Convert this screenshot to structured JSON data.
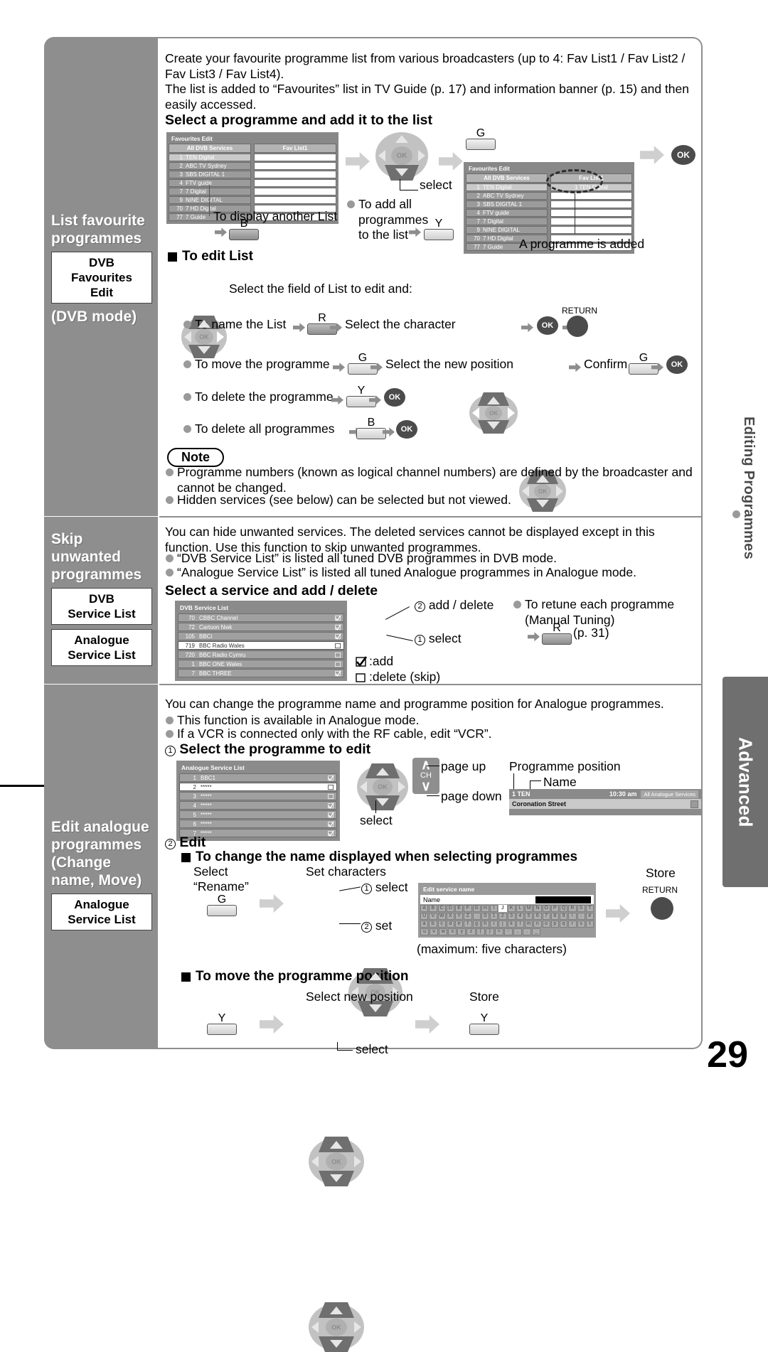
{
  "page_number": "29",
  "side_tabs": {
    "editing": "Editing Programmes",
    "advanced": "Advanced"
  },
  "sidebar": [
    {
      "title": "List favourite programmes",
      "buttons": [
        "DVB\nFavourites\nEdit"
      ],
      "mode": "(DVB mode)"
    },
    {
      "title": "Skip unwanted programmes",
      "buttons": [
        "DVB\nService List",
        "Analogue\nService List"
      ],
      "mode": ""
    },
    {
      "title": "Edit analogue programmes (Change name, Move)",
      "buttons": [
        "Analogue\nService List"
      ],
      "mode": ""
    }
  ],
  "section1": {
    "intro1": "Create your favourite programme list from various broadcasters (up to 4: Fav List1 / Fav List2 / Fav List3 / Fav List4).",
    "intro2": "The list is added to “Favourites” list in TV Guide (p. 17) and information banner (p. 15) and then easily accessed.",
    "heading": "Select a programme and add it to the list",
    "screen1": {
      "title": "Favourites Edit",
      "col1_header": "All DVB Services",
      "col2_header": "Fav List1",
      "rows": [
        {
          "num": "1",
          "name": "TEN Digital"
        },
        {
          "num": "2",
          "name": "ABC TV Sydney"
        },
        {
          "num": "3",
          "name": "SBS DIGITAL 1"
        },
        {
          "num": "4",
          "name": "FTV guide"
        },
        {
          "num": "7",
          "name": "7 Digital"
        },
        {
          "num": "9",
          "name": "NINE DIGITAL"
        },
        {
          "num": "70",
          "name": "7 HD Digital"
        },
        {
          "num": "77",
          "name": "7 Guide"
        }
      ]
    },
    "screen2": {
      "title": "Favourites Edit",
      "col1_header": "All DVB Services",
      "col2_header": "Fav List1",
      "added_row": "1 TEN Digital"
    },
    "select_label": "select",
    "key_G": "G",
    "key_Y": "Y",
    "key_B": "B",
    "key_R": "R",
    "ok_label": "OK",
    "display_another": "To display another List",
    "add_all": "To add all programmes to the list",
    "programme_added": "A programme is added",
    "edit_list_heading": "To edit List",
    "select_field": "Select the field of List to edit and:",
    "name_list": "To name the List",
    "select_char": "Select the character",
    "return_label": "RETURN",
    "move_prog": "To move the programme",
    "select_new_pos": "Select the new position",
    "confirm": "Confirm",
    "delete_prog": "To delete the programme",
    "delete_all": "To delete all programmes",
    "note_title": "Note",
    "notes": [
      "Programme numbers (known as logical channel numbers) are defined by the broadcaster and cannot be changed.",
      "Hidden services (see below) can be selected but not viewed."
    ]
  },
  "section2": {
    "intro": "You can hide unwanted services. The deleted services cannot be displayed except in this function. Use this function to skip unwanted programmes.",
    "bullets": [
      "“DVB Service List” is listed all tuned DVB programmes in DVB mode.",
      "“Analogue Service List” is listed all tuned Analogue programmes in Analogue mode."
    ],
    "heading": "Select a service and add / delete",
    "screen": {
      "title": "DVB Service List",
      "rows": [
        {
          "num": "70",
          "name": "CBBC Channel",
          "checked": true,
          "sel": false
        },
        {
          "num": "72",
          "name": "Cartoon Nwk",
          "checked": true,
          "sel": false
        },
        {
          "num": "105",
          "name": "BBCi",
          "checked": true,
          "sel": false
        },
        {
          "num": "719",
          "name": "BBC Radio Wales",
          "checked": false,
          "sel": true
        },
        {
          "num": "720",
          "name": "BBC Radio Cymru",
          "checked": false,
          "sel": false
        },
        {
          "num": "1",
          "name": "BBC ONE Wales",
          "checked": false,
          "sel": false
        },
        {
          "num": "7",
          "name": "BBC THREE",
          "checked": true,
          "sel": false
        }
      ]
    },
    "step2": "add / delete",
    "step1": "select",
    "legend_add": ":add",
    "legend_delete": ":delete (skip)",
    "retune": "To retune each programme (Manual Tuning)",
    "retune_key": "R",
    "retune_page": "(p. 31)"
  },
  "section3": {
    "intro": "You can change the programme name and programme position for Analogue programmes.",
    "bullets": [
      "This function is available in Analogue mode.",
      "If a VCR is connected only with the RF cable, edit “VCR”."
    ],
    "step1_heading": "Select the programme to edit",
    "screen": {
      "title": "Analogue Service List",
      "rows": [
        {
          "num": "1",
          "name": "BBC1",
          "checked": true,
          "sel": false
        },
        {
          "num": "2",
          "name": "*****",
          "checked": false,
          "sel": true
        },
        {
          "num": "3",
          "name": "*****",
          "checked": false,
          "sel": false
        },
        {
          "num": "4",
          "name": "*****",
          "checked": true,
          "sel": false
        },
        {
          "num": "5",
          "name": "*****",
          "checked": true,
          "sel": false
        },
        {
          "num": "6",
          "name": "*****",
          "checked": true,
          "sel": false
        },
        {
          "num": "7",
          "name": "*****",
          "checked": true,
          "sel": false
        }
      ]
    },
    "select_label": "select",
    "page_up": "page up",
    "page_down": "page down",
    "ch_label": "CH",
    "prog_position_label": "Programme position",
    "name_label": "Name",
    "banner": {
      "position": "1 TEN",
      "time": "10:30 am",
      "services": "All Analogue Services",
      "programme": "Coronation Street"
    },
    "step2_heading": "Edit",
    "change_name_heading": "To change the name displayed when selecting programmes",
    "select_rename": "Select “Rename”",
    "key_G": "G",
    "set_characters": "Set characters",
    "kb_step1": "select",
    "kb_step2": "set",
    "store": "Store",
    "return_label": "RETURN",
    "keyboard": {
      "title": "Edit service name",
      "name_field_label": "Name",
      "highlight_key": "J",
      "rows": [
        [
          "A",
          "B",
          "C",
          "D",
          "E",
          "F",
          "G",
          "H",
          "I",
          "J",
          "K",
          "L",
          "M",
          "N",
          "O",
          "P",
          "Q",
          "R",
          "S",
          "T"
        ],
        [
          "U",
          "V",
          "W",
          "X",
          "Y",
          "Z",
          " ",
          "0",
          "1",
          "2",
          "3",
          "4",
          "5",
          "6",
          "7",
          "8",
          "9",
          "!",
          ":",
          "#"
        ],
        [
          "a",
          "b",
          "c",
          "d",
          "e",
          "f",
          "g",
          "h",
          "i",
          "j",
          "k",
          "l",
          "m",
          "n",
          "o",
          "p",
          "q",
          "r",
          "s",
          "t"
        ],
        [
          "u",
          "v",
          "w",
          "x",
          "y",
          "z",
          "(",
          ")",
          "+",
          "-",
          ",",
          ".",
          "_"
        ]
      ]
    },
    "max_chars": "(maximum: five characters)",
    "move_heading": "To move the programme position",
    "select_new_position": "Select new position",
    "store2": "Store",
    "key_Y": "Y",
    "select_label2": "select"
  }
}
